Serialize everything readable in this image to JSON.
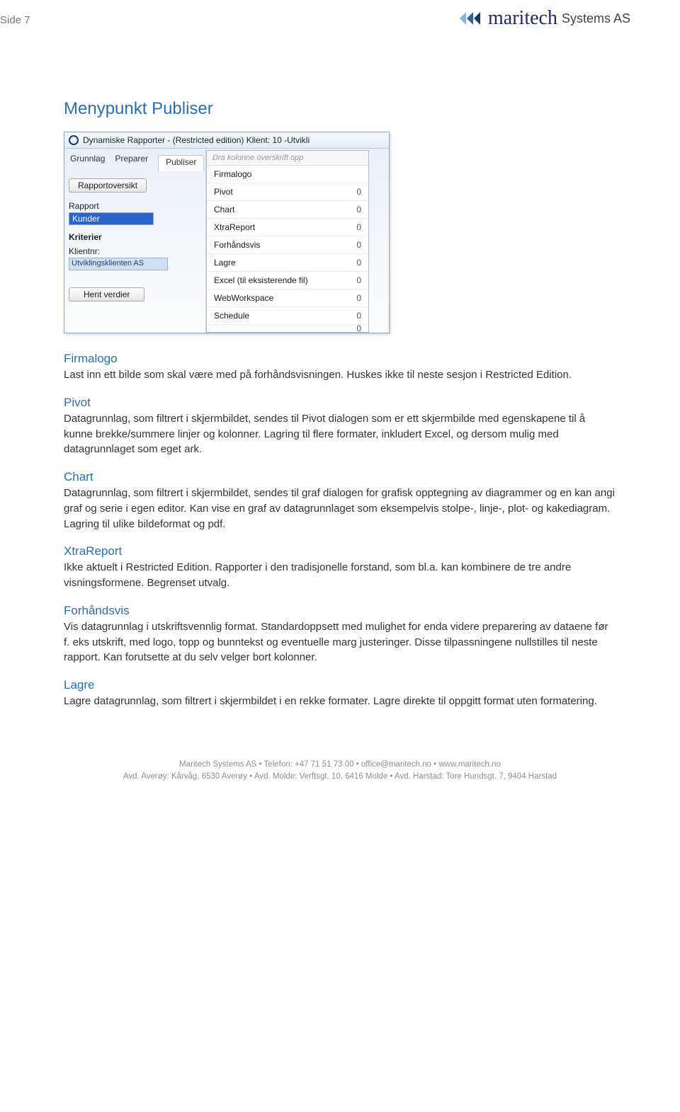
{
  "page_side": "Side 7",
  "brand": {
    "name": "maritech",
    "suffix": "Systems AS"
  },
  "main_title": "Menypunkt Publiser",
  "screenshot": {
    "window_title": "Dynamiske Rapporter - (Restricted edition)  Klient: 10 -Utvikli",
    "tabs": {
      "t1": "Grunnlag",
      "t2": "Preparer",
      "t3": "Publiser"
    },
    "hint": "Dra kolonne overskrift opp",
    "btn_overview": "Rapportoversikt",
    "lbl_rapport": "Rapport",
    "sel_rapport": "Kunder",
    "lbl_kriterier": "Kriterier",
    "lbl_klientnr": "Klientnr:",
    "field_klientnr": "Utviklingsklienten AS",
    "btn_hent": "Hent verdier",
    "menu": {
      "m0": "Firmalogo",
      "m1": "Pivot",
      "m2": "Chart",
      "m3": "XtraReport",
      "m4": "Forhåndsvis",
      "m5": "Lagre",
      "m6": "Excel (til eksisterende fil)",
      "m7": "WebWorkspace",
      "m8": "Schedule"
    }
  },
  "sections": {
    "firmalogo": {
      "h": "Firmalogo",
      "p": "Last inn ett bilde som skal være med på forhåndsvisningen. Huskes ikke til neste sesjon i Restricted Edition."
    },
    "pivot": {
      "h": "Pivot",
      "p1": "Datagrunnlag, som filtrert i skjermbildet, sendes til Pivot dialogen som er ett skjermbilde med egenskapene til å kunne brekke/summere linjer og kolonner. Lagring til flere formater, inkludert Excel, og dersom mulig med datagrunnlaget som eget ark."
    },
    "chart": {
      "h": "Chart",
      "p": "Datagrunnlag, som filtrert i skjermbildet, sendes til graf dialogen for grafisk opptegning av diagrammer og en kan angi graf og serie i egen editor. Kan vise en graf av datagrunnlaget som eksempelvis stolpe-, linje-, plot- og kakediagram. Lagring til ulike bildeformat og pdf."
    },
    "xtra": {
      "h": "XtraReport",
      "p": "Ikke aktuelt i Restricted Edition. Rapporter i den tradisjonelle forstand, som bl.a. kan kombinere de tre andre visningsformene. Begrenset utvalg."
    },
    "forhandsvis": {
      "h": "Forhåndsvis",
      "p": "Vis datagrunnlag i utskriftsvennlig format. Standardoppsett med mulighet for enda videre preparering av dataene før f. eks utskrift, med logo, topp og bunntekst og eventuelle marg justeringer. Disse tilpassningene nullstilles til neste rapport. Kan forutsette at du selv velger bort kolonner."
    },
    "lagre": {
      "h": "Lagre",
      "p": "Lagre datagrunnlag, som filtrert i skjermbildet i en rekke formater. Lagre direkte til oppgitt format uten formatering."
    }
  },
  "footer": {
    "line1": "Maritech Systems AS  •  Telefon: +47 71 51 73 00  •  office@maritech.no  •  www.maritech.no",
    "line2": "Avd. Averøy: Kårvåg, 6530 Averøy  •  Avd. Molde: Verftsgt. 10, 6416 Molde  •  Avd. Harstad: Tore Hundsgt. 7, 9404 Harstad"
  }
}
